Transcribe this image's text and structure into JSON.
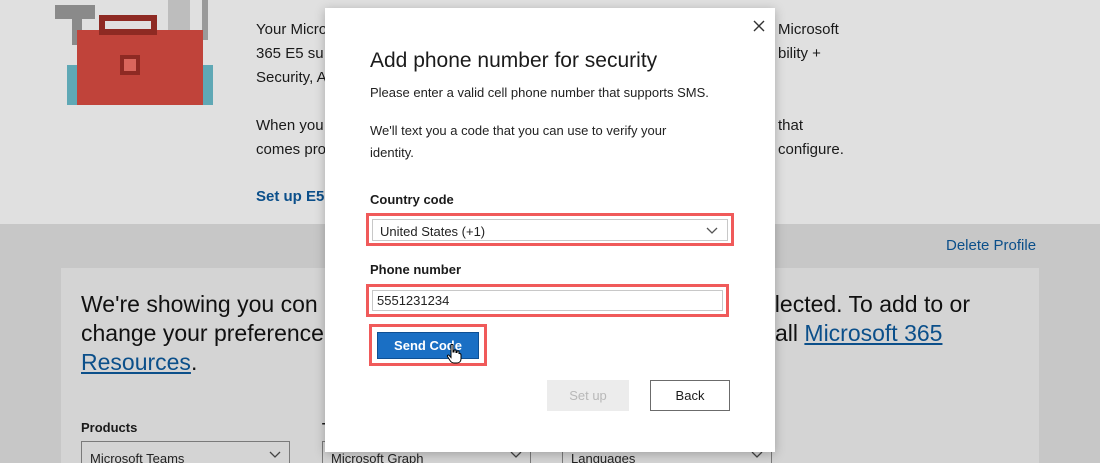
{
  "background": {
    "intro_line1": "Your Microsoft",
    "intro_line1_right": "Microsoft",
    "intro_line2": "365 E5 su",
    "intro_line2_right": "bility +",
    "intro_line3": "Security, A",
    "para_line1": "When you",
    "para_line1_right": "that",
    "para_line2": "comes pro",
    "para_line2_right": "configure.",
    "setup_link": "Set up E5",
    "delete_profile": "Delete Profile",
    "card": {
      "line1_left": "We're showing you con",
      "line1_right": "elected. To add to or",
      "line2_left": "change your preference",
      "line2_right_plain": "all",
      "line2_right_link": "Microsoft 365",
      "line3_link": "Resources",
      "line3_suffix": "."
    },
    "filters": {
      "products_label": "Products",
      "products_value": "Microsoft Teams",
      "second_label": "T",
      "second_value": "Microsoft Graph",
      "third_value": "Languages"
    }
  },
  "modal": {
    "title": "Add phone number for security",
    "subtitle": "Please enter a valid cell phone number that supports SMS.",
    "description": "We'll text you a code that you can use to verify your identity.",
    "country_label": "Country code",
    "country_value": "United States (+1)",
    "phone_label": "Phone number",
    "phone_value": "5551231234",
    "send_code": "Send Code",
    "setup": "Set up",
    "back": "Back"
  },
  "colors": {
    "accent": "#1a6fc4",
    "highlight": "#f05a5a",
    "link": "#0b4f8a"
  },
  "icons": {
    "close": "close-icon",
    "chevron": "chevron-down-icon",
    "cursor": "hand-pointer-icon"
  }
}
